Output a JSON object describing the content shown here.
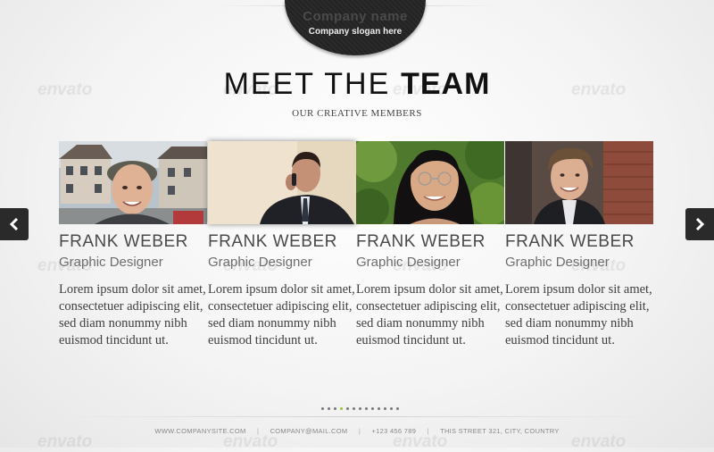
{
  "brand": {
    "name": "Company name",
    "slogan": "Company slogan here"
  },
  "title": {
    "thin": "MEET THE",
    "bold": "TEAM"
  },
  "subtitle": "OUR CREATIVE MEMBERS",
  "watermark": "envato",
  "team": [
    {
      "name": "FRANK WEBER",
      "role": "Graphic Designer",
      "bio": "Lorem ipsum dolor sit amet, consectetuer adipiscing elit, sed diam nonummy nibh euismod tincidunt ut."
    },
    {
      "name": "FRANK WEBER",
      "role": "Graphic Designer",
      "bio": "Lorem ipsum dolor sit amet, consectetuer adipiscing elit, sed diam nonummy nibh euismod tincidunt ut."
    },
    {
      "name": "FRANK WEBER",
      "role": "Graphic Designer",
      "bio": "Lorem ipsum dolor sit amet, consectetuer adipiscing elit, sed diam nonummy nibh euismod tincidunt ut."
    },
    {
      "name": "FRANK WEBER",
      "role": "Graphic Designer",
      "bio": "Lorem ipsum dolor sit amet, consectetuer adipiscing elit, sed diam nonummy nibh euismod tincidunt ut."
    }
  ],
  "nav": {
    "prev_icon": "chevron-left-icon",
    "next_icon": "chevron-right-icon"
  },
  "pagination": {
    "total": 13,
    "active": 3
  },
  "footer": {
    "website": "WWW.COMPANYSITE.COM",
    "email": "COMPANY@MAIL.COM",
    "phone": "+123 456 789",
    "address": "THIS STREET 321, CITY, COUNTRY",
    "separator": "|"
  },
  "colors": {
    "accent": "#9bc52b",
    "dark": "#2a2a2a"
  }
}
